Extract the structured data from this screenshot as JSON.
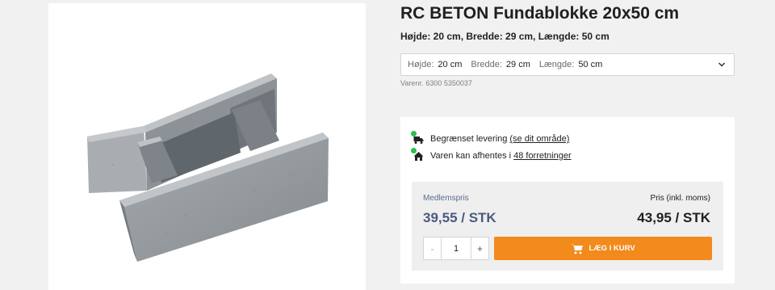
{
  "product": {
    "title": "RC BETON Fundablokke 20x50 cm",
    "subtitle": "Højde: 20 cm, Bredde: 29 cm, Længde: 50 cm",
    "image_alt": "concrete-foundation-block",
    "variant": [
      {
        "key": "Højde:",
        "value": "20 cm"
      },
      {
        "key": "Bredde:",
        "value": "29 cm"
      },
      {
        "key": "Længde:",
        "value": "50 cm"
      }
    ],
    "item_number_label": "Varenr.",
    "item_number": "6300 5350037"
  },
  "availability": {
    "delivery_text": "Begrænset levering",
    "delivery_link": "(se dit område)",
    "pickup_text": "Varen kan afhentes i",
    "pickup_link": "48 forretninger",
    "status_color": "#2ebd4e"
  },
  "pricing": {
    "member_label": "Medlemspris",
    "member_price": "39,55 / STK",
    "list_label": "Pris (inkl. moms)",
    "list_price": "43,95 / STK"
  },
  "cart": {
    "minus": "-",
    "quantity": "1",
    "plus": "+",
    "add_label": "LÆG I KURV",
    "button_color": "#f28a1c"
  },
  "icons": {
    "delivery": "truck-icon",
    "pickup": "store-icon",
    "dropdown": "chevron-down-icon",
    "cart": "cart-icon"
  }
}
